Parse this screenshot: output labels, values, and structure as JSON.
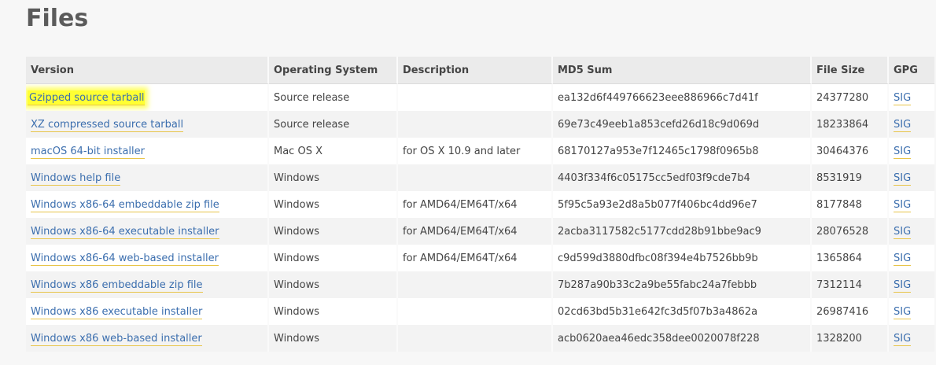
{
  "page": {
    "title": "Files"
  },
  "table": {
    "headers": [
      "Version",
      "Operating System",
      "Description",
      "MD5 Sum",
      "File Size",
      "GPG"
    ],
    "rows": [
      {
        "version": "Gzipped source tarball",
        "os": "Source release",
        "description": "",
        "md5": "ea132d6f449766623eee886966c7d41f",
        "size": "24377280",
        "gpg": "SIG",
        "highlighted": true
      },
      {
        "version": "XZ compressed source tarball",
        "os": "Source release",
        "description": "",
        "md5": "69e73c49eeb1a853cefd26d18c9d069d",
        "size": "18233864",
        "gpg": "SIG"
      },
      {
        "version": "macOS 64-bit installer",
        "os": "Mac OS X",
        "description": "for OS X 10.9 and later",
        "md5": "68170127a953e7f12465c1798f0965b8",
        "size": "30464376",
        "gpg": "SIG"
      },
      {
        "version": "Windows help file",
        "os": "Windows",
        "description": "",
        "md5": "4403f334f6c05175cc5edf03f9cde7b4",
        "size": "8531919",
        "gpg": "SIG"
      },
      {
        "version": "Windows x86-64 embeddable zip file",
        "os": "Windows",
        "description": "for AMD64/EM64T/x64",
        "md5": "5f95c5a93e2d8a5b077f406bc4dd96e7",
        "size": "8177848",
        "gpg": "SIG"
      },
      {
        "version": "Windows x86-64 executable installer",
        "os": "Windows",
        "description": "for AMD64/EM64T/x64",
        "md5": "2acba3117582c5177cdd28b91bbe9ac9",
        "size": "28076528",
        "gpg": "SIG"
      },
      {
        "version": "Windows x86-64 web-based installer",
        "os": "Windows",
        "description": "for AMD64/EM64T/x64",
        "md5": "c9d599d3880dfbc08f394e4b7526bb9b",
        "size": "1365864",
        "gpg": "SIG"
      },
      {
        "version": "Windows x86 embeddable zip file",
        "os": "Windows",
        "description": "",
        "md5": "7b287a90b33c2a9be55fabc24a7febbb",
        "size": "7312114",
        "gpg": "SIG"
      },
      {
        "version": "Windows x86 executable installer",
        "os": "Windows",
        "description": "",
        "md5": "02cd63bd5b31e642fc3d5f07b3a4862a",
        "size": "26987416",
        "gpg": "SIG"
      },
      {
        "version": "Windows x86 web-based installer",
        "os": "Windows",
        "description": "",
        "md5": "acb0620aea46edc358dee0020078f228",
        "size": "1328200",
        "gpg": "SIG"
      }
    ]
  },
  "colors": {
    "link": "#3b6eae",
    "link_underline": "#e8c54a",
    "highlight": "#ffff33",
    "header_bg": "#ebebeb",
    "row_alt_bg": "#f3f3f3"
  }
}
